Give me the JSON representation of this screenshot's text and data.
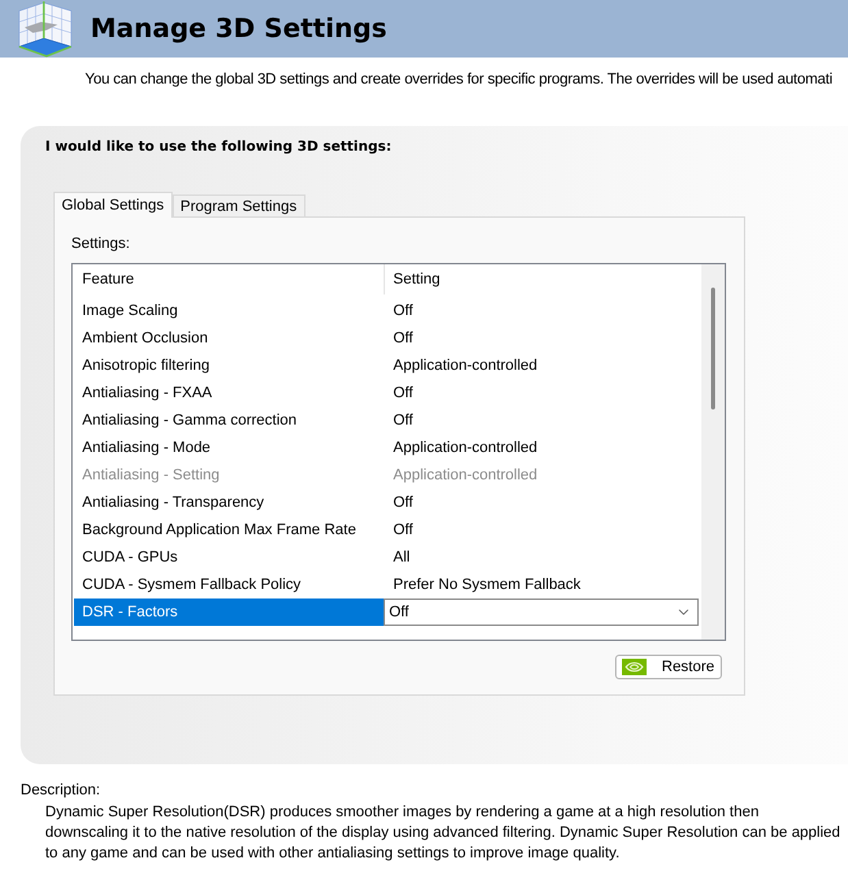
{
  "header": {
    "title": "Manage 3D Settings",
    "intro": "You can change the global 3D settings and create overrides for specific programs. The overrides will be used automati"
  },
  "panel": {
    "heading": "I would like to use the following 3D settings:",
    "tabs": [
      {
        "label": "Global Settings",
        "selected": true
      },
      {
        "label": "Program Settings",
        "selected": false
      }
    ],
    "settings_label": "Settings:",
    "table": {
      "columns": [
        "Feature",
        "Setting"
      ],
      "rows": [
        {
          "feature": "Image Scaling",
          "setting": "Off",
          "disabled": false,
          "selected": false
        },
        {
          "feature": "Ambient Occlusion",
          "setting": "Off",
          "disabled": false,
          "selected": false
        },
        {
          "feature": "Anisotropic filtering",
          "setting": "Application-controlled",
          "disabled": false,
          "selected": false
        },
        {
          "feature": "Antialiasing - FXAA",
          "setting": "Off",
          "disabled": false,
          "selected": false
        },
        {
          "feature": "Antialiasing - Gamma correction",
          "setting": "Off",
          "disabled": false,
          "selected": false
        },
        {
          "feature": "Antialiasing - Mode",
          "setting": "Application-controlled",
          "disabled": false,
          "selected": false
        },
        {
          "feature": "Antialiasing - Setting",
          "setting": "Application-controlled",
          "disabled": true,
          "selected": false
        },
        {
          "feature": "Antialiasing - Transparency",
          "setting": "Off",
          "disabled": false,
          "selected": false
        },
        {
          "feature": "Background Application Max Frame Rate",
          "setting": "Off",
          "disabled": false,
          "selected": false
        },
        {
          "feature": "CUDA - GPUs",
          "setting": "All",
          "disabled": false,
          "selected": false
        },
        {
          "feature": "CUDA - Sysmem Fallback Policy",
          "setting": "Prefer No Sysmem Fallback",
          "disabled": false,
          "selected": false
        },
        {
          "feature": "DSR - Factors",
          "setting": "Off",
          "disabled": false,
          "selected": true
        }
      ]
    },
    "restore_button": "Restore"
  },
  "description": {
    "label": "Description:",
    "text": "Dynamic Super Resolution(DSR) produces smoother images by rendering a game at a high resolution then downscaling it to the native resolution of the display using advanced filtering. Dynamic Super Resolution can be applied to any game and can be used with other antialiasing settings to improve image quality."
  }
}
